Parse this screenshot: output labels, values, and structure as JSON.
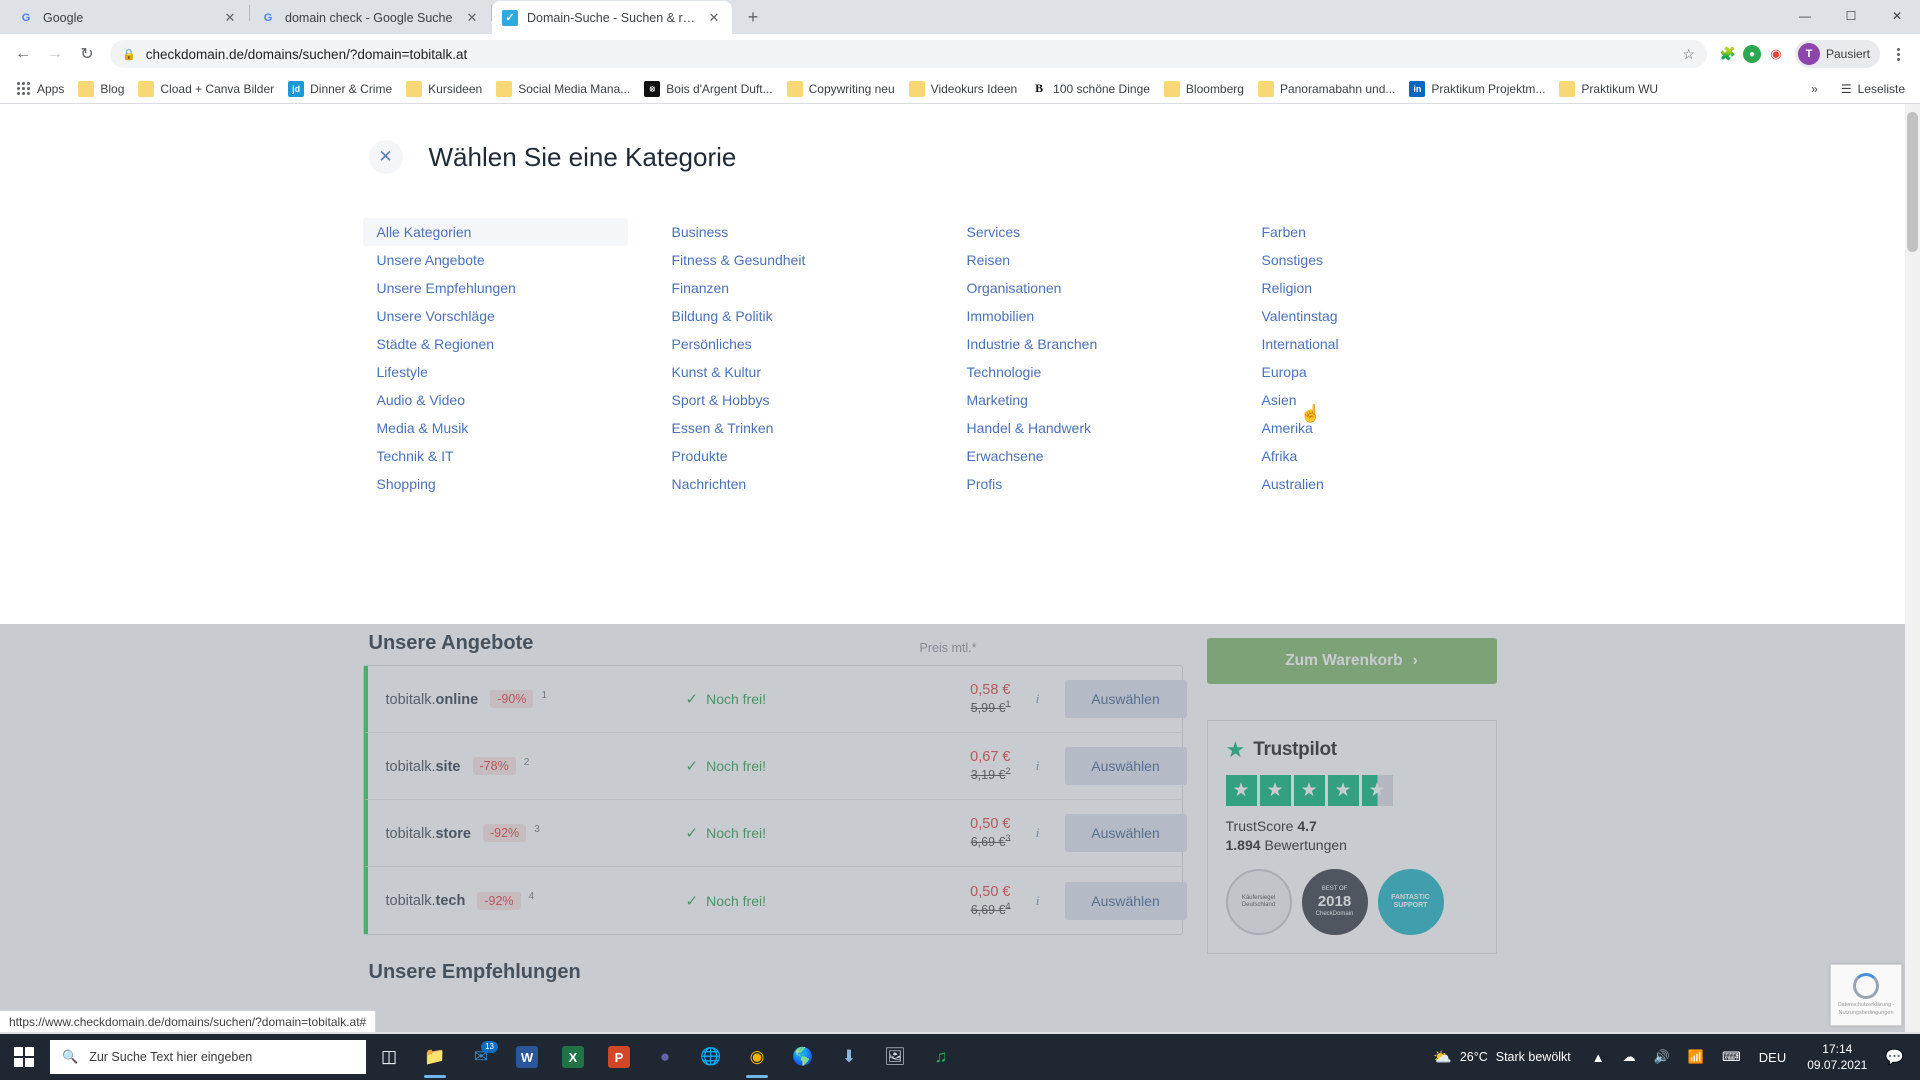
{
  "browser": {
    "tabs": [
      {
        "title": "Google",
        "favicon": "google-icon",
        "active": false
      },
      {
        "title": "domain check - Google Suche",
        "favicon": "google-icon",
        "active": false
      },
      {
        "title": "Domain-Suche - Suchen & regist",
        "favicon": "checkdomain-icon",
        "active": true
      }
    ],
    "new_tab_label": "+",
    "window_controls": {
      "minimize": "—",
      "maximize": "☐",
      "close": "✕"
    },
    "nav": {
      "back": "←",
      "forward": "→",
      "reload": "↻"
    },
    "omnibox": {
      "url": "checkdomain.de/domains/suchen/?domain=tobitalk.at",
      "lock_icon": "lock-icon",
      "star_icon": "star-icon"
    },
    "extensions": [
      "extension-puzzle-icon",
      "adblock-icon",
      "extensions-icon"
    ],
    "profile": {
      "initial": "T",
      "label": "Pausiert"
    },
    "menu": "chrome-menu-icon",
    "bookmarks": [
      {
        "label": "Apps",
        "icon": "apps-grid-icon"
      },
      {
        "label": "Blog",
        "icon": "folder-icon"
      },
      {
        "label": "Cload + Canva Bilder",
        "icon": "folder-icon"
      },
      {
        "label": "Dinner & Crime",
        "icon": "jd-icon"
      },
      {
        "label": "Kursideen",
        "icon": "folder-icon"
      },
      {
        "label": "Social Media Mana...",
        "icon": "folder-icon"
      },
      {
        "label": "Bois d'Argent Duft...",
        "icon": "dior-icon"
      },
      {
        "label": "Copywriting neu",
        "icon": "folder-icon"
      },
      {
        "label": "Videokurs Ideen",
        "icon": "folder-icon"
      },
      {
        "label": "100 schöne Dinge",
        "icon": "brand-b-icon"
      },
      {
        "label": "Bloomberg",
        "icon": "folder-icon"
      },
      {
        "label": "Panoramabahn und...",
        "icon": "folder-icon"
      },
      {
        "label": "Praktikum Projektm...",
        "icon": "linkedin-icon"
      },
      {
        "label": "Praktikum WU",
        "icon": "folder-icon"
      }
    ],
    "bookmarks_overflow": "»",
    "reading_list": {
      "label": "Leseliste",
      "icon": "reading-list-icon"
    },
    "status_bar_url": "https://www.checkdomain.de/domains/suchen/?domain=tobitalk.at#"
  },
  "modal": {
    "close_icon": "close-icon",
    "title": "Wählen Sie eine Kategorie",
    "columns": [
      [
        "Alle Kategorien",
        "Unsere Angebote",
        "Unsere Empfehlungen",
        "Unsere Vorschläge",
        "Städte & Regionen",
        "Lifestyle",
        "Audio & Video",
        "Media & Musik",
        "Technik & IT",
        "Shopping"
      ],
      [
        "Business",
        "Fitness & Gesundheit",
        "Finanzen",
        "Bildung & Politik",
        "Persönliches",
        "Kunst & Kultur",
        "Sport & Hobbys",
        "Essen & Trinken",
        "Produkte",
        "Nachrichten"
      ],
      [
        "Services",
        "Reisen",
        "Organisationen",
        "Immobilien",
        "Industrie & Branchen",
        "Technologie",
        "Marketing",
        "Handel & Handwerk",
        "Erwachsene",
        "Profis"
      ],
      [
        "Farben",
        "Sonstiges",
        "Religion",
        "Valentinstag",
        "International",
        "Europa",
        "Asien",
        "Amerika",
        "Afrika",
        "Australien"
      ]
    ],
    "selected": "Alle Kategorien"
  },
  "offers": {
    "title": "Unsere Angebote",
    "price_label": "Preis mtl.*",
    "status_text": "Noch frei!",
    "check_icon": "checkmark-icon",
    "info_icon": "info-icon",
    "select_label": "Auswählen",
    "rows": [
      {
        "name": "tobitalk.",
        "tld": "online",
        "discount": "-90%",
        "sup": "1",
        "price_now": "0,58 €",
        "price_was": "5,99 €",
        "was_sup": "1"
      },
      {
        "name": "tobitalk.",
        "tld": "site",
        "discount": "-78%",
        "sup": "2",
        "price_now": "0,67 €",
        "price_was": "3,19 €",
        "was_sup": "2"
      },
      {
        "name": "tobitalk.",
        "tld": "store",
        "discount": "-92%",
        "sup": "3",
        "price_now": "0,50 €",
        "price_was": "6,69 €",
        "was_sup": "3"
      },
      {
        "name": "tobitalk.",
        "tld": "tech",
        "discount": "-92%",
        "sup": "4",
        "price_now": "0,50 €",
        "price_was": "6,69 €",
        "was_sup": "4"
      }
    ],
    "subtitle": "Unsere Empfehlungen"
  },
  "sidebar": {
    "cart_label": "Zum Warenkorb",
    "cart_chevron": "›",
    "trustpilot": {
      "logo_star": "trustpilot-star-icon",
      "name": "Trustpilot",
      "score_label": "TrustScore",
      "score_value": "4.7",
      "reviews_count": "1.894",
      "reviews_label": "Bewertungen",
      "stars_filled": 4,
      "stars_half": 1
    },
    "badges": [
      {
        "line1": "Käufersiegel",
        "line2": "Deutschland",
        "style": "light"
      },
      {
        "line1": "BEST OF",
        "big": "2018",
        "line2": "CheckDomain",
        "style": "dark"
      },
      {
        "line1": "FANTASTIC",
        "line2": "SUPPORT",
        "style": "teal"
      }
    ]
  },
  "recaptcha": {
    "line1": "Datenschutzerklärung -",
    "line2": "Nutzungsbedingungen"
  },
  "taskbar": {
    "start_icon": "windows-start-icon",
    "search_placeholder": "Zur Suche Text hier eingeben",
    "search_icon": "search-icon",
    "items": [
      {
        "icon": "task-view-icon",
        "name": "task-view",
        "running": false
      },
      {
        "icon": "file-explorer-icon",
        "name": "file-explorer",
        "running": true
      },
      {
        "icon": "mail-icon",
        "name": "mail",
        "running": false,
        "badge": "13"
      },
      {
        "icon": "word-icon",
        "name": "word",
        "running": false
      },
      {
        "icon": "excel-icon",
        "name": "excel",
        "running": false
      },
      {
        "icon": "powerpoint-icon",
        "name": "powerpoint",
        "running": false
      },
      {
        "icon": "teams-icon",
        "name": "teams",
        "running": false
      },
      {
        "icon": "globe-icon",
        "name": "browser-alt",
        "running": false
      },
      {
        "icon": "chrome-icon",
        "name": "chrome",
        "running": true
      },
      {
        "icon": "edge-icon",
        "name": "edge",
        "running": false
      },
      {
        "icon": "download-icon",
        "name": "downloads",
        "running": false
      },
      {
        "icon": "photos-icon",
        "name": "photos",
        "running": false
      },
      {
        "icon": "spotify-icon",
        "name": "spotify",
        "running": false
      }
    ],
    "weather": {
      "icon": "partly-cloudy-icon",
      "temp": "26°C",
      "text": "Stark bewölkt"
    },
    "tray_icons": [
      "chevron-up-icon",
      "onedrive-icon",
      "volume-icon",
      "wifi-icon",
      "keyboard-icon"
    ],
    "language": "DEU",
    "time": "17:14",
    "date": "09.07.2021",
    "notification_icon": "notification-icon"
  },
  "colors": {
    "link": "#4b72b8",
    "discount": "#e03a3a",
    "available": "#2e9e4f",
    "trustpilot_green": "#00b67a",
    "cart_green": "#7eb96a",
    "taskbar": "#1f2733"
  }
}
